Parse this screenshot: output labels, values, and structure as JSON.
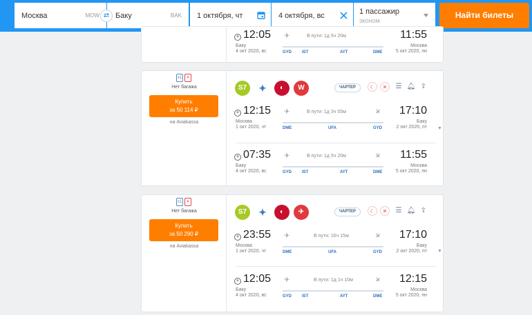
{
  "search": {
    "from_city": "Москва",
    "from_code": "MOW",
    "to_city": "Баку",
    "to_code": "BAK",
    "depart_date": "1 октября, чт",
    "return_date": "4 октября, вс",
    "passengers": "1 пассажир",
    "cabin": "эконом",
    "search_label": "Найти билеты"
  },
  "top_segment": {
    "dep_time": "12:05",
    "arr_time": "11:55",
    "duration": "В пути: 1д 5ч 20м",
    "dep_city": "Баку",
    "dep_date": "4 окт 2020, вс",
    "arr_city": "Москва",
    "arr_date": "5 окт 2020, пн",
    "stops": [
      "GYD",
      "IST",
      "AYT",
      "DME"
    ]
  },
  "tickets": [
    {
      "baggage_label": "Нет багажа",
      "baggage_count": "x1",
      "buy_line1": "Купить",
      "buy_line2": "за 50 114 ₽",
      "seller": "на Aviakassa",
      "charter": "ЧАРТЕР",
      "logo_s7": "S7",
      "outbound": {
        "dep_time": "12:15",
        "arr_time": "17:10",
        "duration": "В пути: 1д 3ч 55м",
        "dep_city": "Москва",
        "dep_date": "1 окт 2020, чт",
        "arr_city": "Баку",
        "arr_date": "2 окт 2020, пт",
        "stops": [
          "DME",
          "UFA",
          "GYD"
        ]
      },
      "return": {
        "dep_time": "07:35",
        "arr_time": "11:55",
        "duration": "В пути: 1д 5ч 20м",
        "dep_city": "Баку",
        "dep_date": "4 окт 2020, вс",
        "arr_city": "Москва",
        "arr_date": "5 окт 2020, пн",
        "stops": [
          "GYD",
          "IST",
          "AYT",
          "DME"
        ]
      }
    },
    {
      "baggage_label": "Нет багажа",
      "baggage_count": "x1",
      "buy_line1": "Купить",
      "buy_line2": "за 50 290 ₽",
      "seller": "на Aviakassa",
      "charter": "ЧАРТЕР",
      "logo_s7": "S7",
      "outbound": {
        "dep_time": "23:55",
        "arr_time": "17:10",
        "duration": "В пути: 16ч 15м",
        "dep_city": "Москва",
        "dep_date": "1 окт 2020, чт",
        "arr_city": "Баку",
        "arr_date": "2 окт 2020, пт",
        "stops": [
          "DME",
          "UFA",
          "GYD"
        ]
      },
      "return": {
        "dep_time": "12:05",
        "arr_time": "12:15",
        "duration": "В пути: 1д 1ч 10м",
        "dep_city": "Баку",
        "dep_date": "4 окт 2020, вс",
        "arr_city": "Москва",
        "arr_date": "5 окт 2020, пн",
        "stops": [
          "GYD",
          "IST",
          "AYT",
          "DME"
        ]
      }
    }
  ],
  "colors": {
    "header": "#2196f3",
    "accent": "#ff7e00",
    "s7": "#a6c927",
    "turkish": "#c8102e",
    "stop_code": "#2e6ec1"
  },
  "icons": [
    "calendar-icon",
    "clear-icon",
    "dropdown-icon",
    "swap-icon",
    "plane-takeoff-icon",
    "plane-landing-icon",
    "bell-icon",
    "share-icon",
    "filter-icon",
    "pin-icon"
  ]
}
